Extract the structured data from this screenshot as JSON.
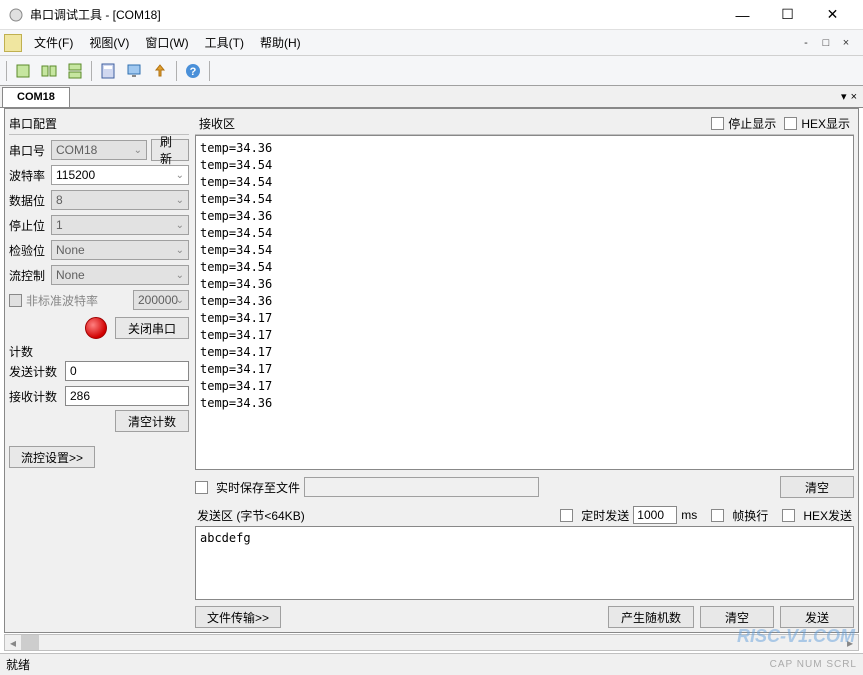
{
  "window": {
    "title": "串口调试工具 - [COM18]"
  },
  "menu": {
    "file": "文件(F)",
    "view": "视图(V)",
    "window": "窗口(W)",
    "tools": "工具(T)",
    "help": "帮助(H)"
  },
  "tab": {
    "active": "COM18"
  },
  "config": {
    "group_title": "串口配置",
    "port_label": "串口号",
    "port_value": "COM18",
    "refresh": "刷新",
    "baud_label": "波特率",
    "baud_value": "115200",
    "databits_label": "数据位",
    "databits_value": "8",
    "stopbits_label": "停止位",
    "stopbits_value": "1",
    "parity_label": "检验位",
    "parity_value": "None",
    "flow_label": "流控制",
    "flow_value": "None",
    "nonstd_label": "非标准波特率",
    "nonstd_value": "200000",
    "close_port": "关闭串口",
    "count_title": "计数",
    "send_count_label": "发送计数",
    "send_count_value": "0",
    "recv_count_label": "接收计数",
    "recv_count_value": "286",
    "clear_count": "清空计数",
    "flow_settings": "流控设置>>"
  },
  "recv": {
    "title": "接收区",
    "stop_display": "停止显示",
    "hex_display": "HEX显示",
    "lines": [
      "temp=34.36",
      "temp=34.54",
      "temp=34.54",
      "temp=34.54",
      "temp=34.36",
      "temp=34.54",
      "temp=34.54",
      "temp=34.54",
      "temp=34.36",
      "temp=34.36",
      "temp=34.17",
      "temp=34.17",
      "temp=34.17",
      "temp=34.17",
      "temp=34.17",
      "temp=34.36"
    ]
  },
  "mid": {
    "realtime_save": "实时保存至文件",
    "clear": "清空"
  },
  "send": {
    "title": "发送区 (字节<64KB)",
    "timed_send": "定时发送",
    "interval": "1000",
    "unit": "ms",
    "frame_wrap": "帧换行",
    "hex_send": "HEX发送",
    "content": "abcdefg",
    "file_transfer": "文件传输>>",
    "gen_random": "产生随机数",
    "clear": "清空",
    "send_btn": "发送"
  },
  "status": {
    "ready": "就绪",
    "indicators": "CAP  NUM  SCRL"
  },
  "watermark": "RISC-V1.COM"
}
